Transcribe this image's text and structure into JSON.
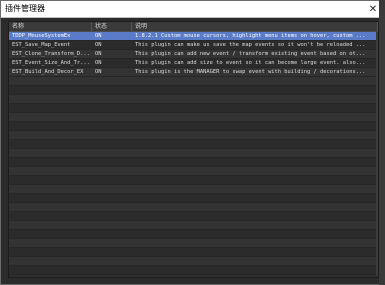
{
  "window": {
    "title": "插件管理器",
    "close_glyph": "✕"
  },
  "columns": {
    "name": "名称",
    "status": "状态",
    "description": "说明"
  },
  "plugins": [
    {
      "name": "TDDP_MouseSystemEx",
      "status": "ON",
      "description": "1.8.2.1 Custom mouse cursors, highlight menu items on hover, custom ..."
    },
    {
      "name": "EST_Save_Map_Event",
      "status": "ON",
      "description": "This plugin can make us save the map events so it won't be reloaded ..."
    },
    {
      "name": "EST_Clone_Transform_D...",
      "status": "ON",
      "description": "This plugin can add new event / transform existing event based on ot..."
    },
    {
      "name": "EST_Event_Size_And_Tr...",
      "status": "ON",
      "description": "This plugin can add size to event so it can become large event. also..."
    },
    {
      "name": "EST_Build_And_Decor_EX",
      "status": "ON",
      "description": "This plugin is the MANAGER to swap event with building / decorations..."
    }
  ],
  "colors": {
    "selection": "#5a7bc7",
    "window_bg": "#2b2b2b",
    "titlebar": "#ffffff"
  }
}
